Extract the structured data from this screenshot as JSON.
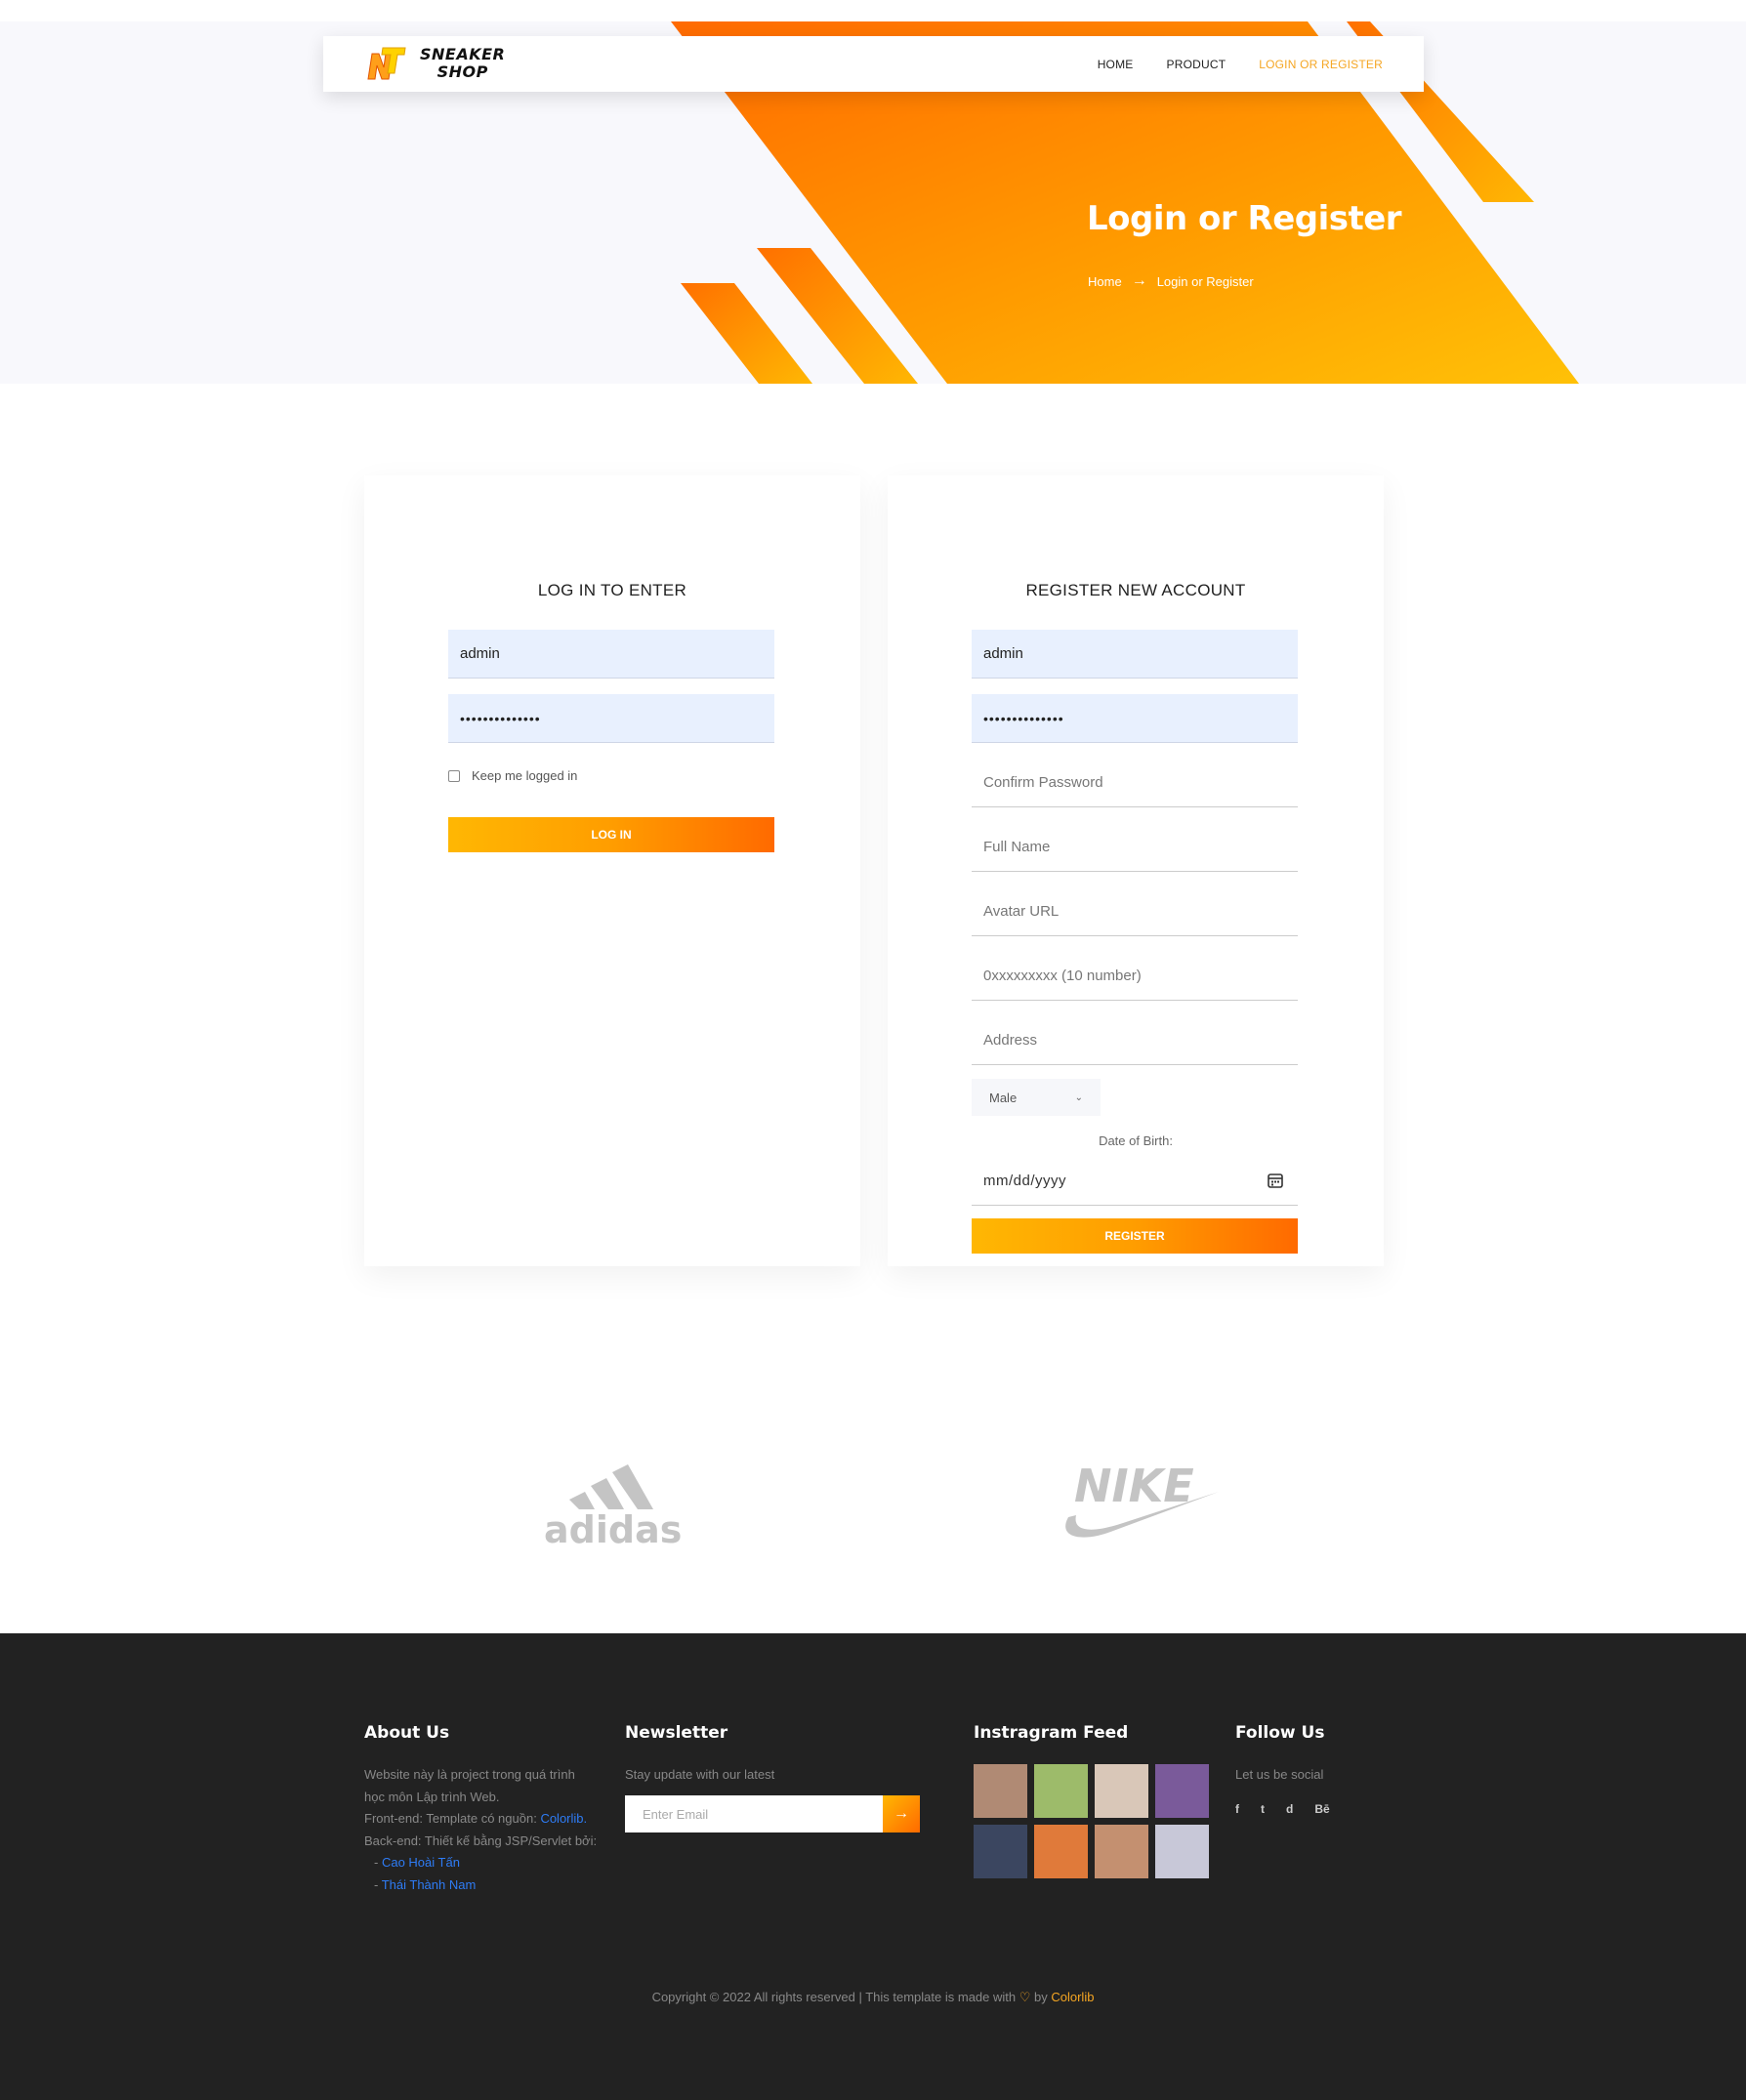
{
  "nav": {
    "logo_line1": "SNEAKER",
    "logo_line2": "SHOP",
    "items": [
      {
        "label": "HOME"
      },
      {
        "label": "PRODUCT"
      },
      {
        "label": "LOGIN OR REGISTER"
      }
    ]
  },
  "hero": {
    "title": "Login or Register",
    "breadcrumb_home": "Home",
    "breadcrumb_arrow": "→",
    "breadcrumb_current": "Login or Register"
  },
  "login": {
    "heading": "LOG IN TO ENTER",
    "username_value": "admin",
    "password_value": "••••••••••••••",
    "remember_label": "Keep me logged in",
    "submit_label": "LOG IN"
  },
  "register": {
    "heading": "REGISTER NEW ACCOUNT",
    "username_value": "admin",
    "password_value": "••••••••••••••",
    "confirm_placeholder": "Confirm Password",
    "fullname_placeholder": "Full Name",
    "avatar_placeholder": "Avatar URL",
    "phone_placeholder": "0xxxxxxxxx (10 number)",
    "address_placeholder": "Address",
    "gender_selected": "Male",
    "dob_label": "Date of Birth:",
    "dob_placeholder": "mm/dd/yyyy",
    "submit_label": "REGISTER"
  },
  "brands": {
    "adidas": "adidas",
    "nike": "NIKE"
  },
  "footer": {
    "about": {
      "heading": "About Us",
      "line1": "Website này là project trong quá trình",
      "line2": "học môn Lập trình Web.",
      "line3_prefix": "Front-end: Template có nguồn: ",
      "line3_link": "Colorlib.",
      "line4": "Back-end: Thiết kế bằng JSP/Servlet bởi:",
      "author1_prefix": "- ",
      "author1": "Cao Hoài Tấn",
      "author2_prefix": "- ",
      "author2": "Thái Thành Nam"
    },
    "newsletter": {
      "heading": "Newsletter",
      "text": "Stay update with our latest",
      "placeholder": "Enter Email",
      "button_arrow": "→"
    },
    "instagram": {
      "heading": "Instragram Feed",
      "tiles": [
        "#b08a74",
        "#9dbb6a",
        "#d9c7b8",
        "#7a5a9a",
        "#3b4660",
        "#e07a3a",
        "#c49070",
        "#c8c8d8"
      ]
    },
    "follow": {
      "heading": "Follow Us",
      "text": "Let us be social",
      "icons": [
        "f",
        "t",
        "d",
        "Bē"
      ]
    },
    "copyright_prefix": "Copyright © 2022 All rights reserved | This template is made with ",
    "copyright_by": " by ",
    "copyright_link": "Colorlib"
  },
  "colors": {
    "accent": "#f5a623",
    "orange_dark": "#ff6a00",
    "orange_light": "#ffb703",
    "footer_bg": "#222222"
  }
}
